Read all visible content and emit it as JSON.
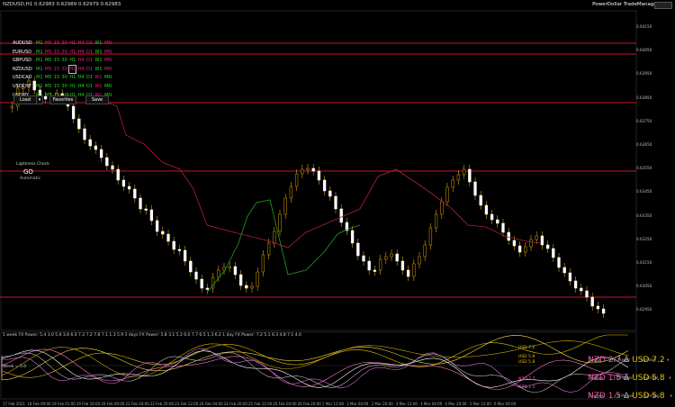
{
  "header": {
    "symbol_line": "NZDUSD,H1  0.62983  0.62989  0.62979  0.62983",
    "plugin": "PowerDollar TradeManager"
  },
  "pairs": [
    {
      "name": "AUDUSD",
      "tfs": [
        [
          "M1",
          "g"
        ],
        [
          "M5",
          "r"
        ],
        [
          "15",
          "r"
        ],
        [
          "30",
          "r"
        ],
        [
          "H1",
          "r"
        ],
        [
          "H4",
          "r"
        ],
        [
          "D1",
          "r"
        ],
        [
          "W1",
          "g"
        ],
        [
          "MN",
          "r"
        ]
      ]
    },
    {
      "name": "EURUSD",
      "tfs": [
        [
          "M1",
          "g"
        ],
        [
          "M5",
          "r"
        ],
        [
          "15",
          "r"
        ],
        [
          "30",
          "r"
        ],
        [
          "H1",
          "r"
        ],
        [
          "H4",
          "r"
        ],
        [
          "D1",
          "r"
        ],
        [
          "W1",
          "g"
        ],
        [
          "MN",
          "r"
        ]
      ]
    },
    {
      "name": "GBPUSD",
      "tfs": [
        [
          "M1",
          "g"
        ],
        [
          "M5",
          "g"
        ],
        [
          "15",
          "g"
        ],
        [
          "30",
          "g"
        ],
        [
          "H1",
          "g"
        ],
        [
          "H4",
          "r"
        ],
        [
          "D1",
          "r"
        ],
        [
          "W1",
          "g"
        ],
        [
          "MN",
          "r"
        ]
      ]
    },
    {
      "name": "NZDUSD",
      "tfs": [
        [
          "M1",
          "g"
        ],
        [
          "M5",
          "r"
        ],
        [
          "15",
          "r"
        ],
        [
          "30",
          "r"
        ],
        [
          "H1",
          "r"
        ],
        [
          "H4",
          "r"
        ],
        [
          "D1",
          "r"
        ],
        [
          "W1",
          "g"
        ],
        [
          "MN",
          "r"
        ]
      ]
    },
    {
      "name": "USDCAD",
      "tfs": [
        [
          "M1",
          "g"
        ],
        [
          "M5",
          "g"
        ],
        [
          "15",
          "g"
        ],
        [
          "30",
          "g"
        ],
        [
          "H1",
          "g"
        ],
        [
          "H4",
          "g"
        ],
        [
          "D1",
          "g"
        ],
        [
          "W1",
          "r"
        ],
        [
          "MN",
          "g"
        ]
      ]
    },
    {
      "name": "USDCHF",
      "tfs": [
        [
          "M1",
          "g"
        ],
        [
          "M5",
          "g"
        ],
        [
          "15",
          "g"
        ],
        [
          "30",
          "g"
        ],
        [
          "H1",
          "g"
        ],
        [
          "H4",
          "g"
        ],
        [
          "D1",
          "g"
        ],
        [
          "W1",
          "r"
        ],
        [
          "MN",
          "g"
        ]
      ]
    },
    {
      "name": "USDJPY",
      "tfs": [
        [
          "M1",
          "g"
        ],
        [
          "M5",
          "g"
        ],
        [
          "15",
          "g"
        ],
        [
          "30",
          "g"
        ],
        [
          "H1",
          "g"
        ],
        [
          "H4",
          "g"
        ],
        [
          "D1",
          "g"
        ],
        [
          "W1",
          "r"
        ],
        [
          "MN",
          "g"
        ]
      ]
    }
  ],
  "buttons": {
    "load": "Load",
    "favorites": "Favorites",
    "save": "Save",
    "dropdown": "▾"
  },
  "lightness": {
    "title": "Lightness Check",
    "go": "GO",
    "mode": "Automatic"
  },
  "price_axis": [
    "0.64150",
    "0.64050",
    "0.63950",
    "0.63850",
    "0.63750",
    "0.63650",
    "0.63550",
    "0.63450",
    "0.63350",
    "0.63250",
    "0.63150",
    "0.63050",
    "0.62950"
  ],
  "date_axis": [
    "17 Feb 2021",
    "18 Feb 09:00",
    "19 Feb 01:00",
    "19 Feb 16:00",
    "20 Feb 00:00",
    "22 Feb 04:00",
    "22 Feb 20:00",
    "23 Feb 12:00",
    "24 Feb 04:00",
    "24 Feb 20:00",
    "25 Feb 12:00",
    "26 Feb 04:00",
    "26 Feb 20:00",
    "1 Mar 12:00",
    "2 Mar 04:00",
    "2 Mar 20:00",
    "3 Mar 12:00",
    "4 Mar 04:00",
    "4 Mar 20:00",
    "5 Mar 12:00",
    "6 Mar 04:00"
  ],
  "indicator": {
    "header": "1 week FX Power: 5.4  3.0  5.6  3.8  6.0  7.2  7.2  7.8  7.1  1.3  5.9     3 days FX Power: 5.8  3.1  5.2  6.0  7.7  6.5  1.3  6.2     1 day FX Power: 7.2  5.1  6.3  4.8  7.1  4.0",
    "left_label": "Week = 5.6",
    "line_labels": [
      {
        "text": "USD 7.2",
        "color": "#e6c200"
      },
      {
        "text": "USD 5.8",
        "color": "#e6c200"
      },
      {
        "text": "USD 5.8",
        "color": "#e6c200"
      },
      {
        "text": "NZD 2.7",
        "color": "#ff66cc"
      },
      {
        "text": "NZD 1.5",
        "color": "#ff66cc"
      }
    ]
  },
  "strength_panel": [
    {
      "nzd": "NZD 2.7",
      "usd": "USD 7.2",
      "period": "1 day",
      "fx": "FX Power",
      "sym": "Symbol"
    },
    {
      "nzd": "NZD 1.5",
      "usd": "USD 5.8",
      "period": "3 days",
      "fx": "FX Power",
      "sym": "Symbol"
    },
    {
      "nzd": "NZD 1.5",
      "usd": "USD 5.8",
      "period": "1 week",
      "fx": "FX Power",
      "sym": "Symbol"
    }
  ],
  "colors": {
    "bull": "#ffffff",
    "bear": "#ffffff",
    "accent_red": "#c8142a",
    "nzd": "#ff55aa",
    "usd": "#e6c200",
    "green": "#22cc22"
  }
}
